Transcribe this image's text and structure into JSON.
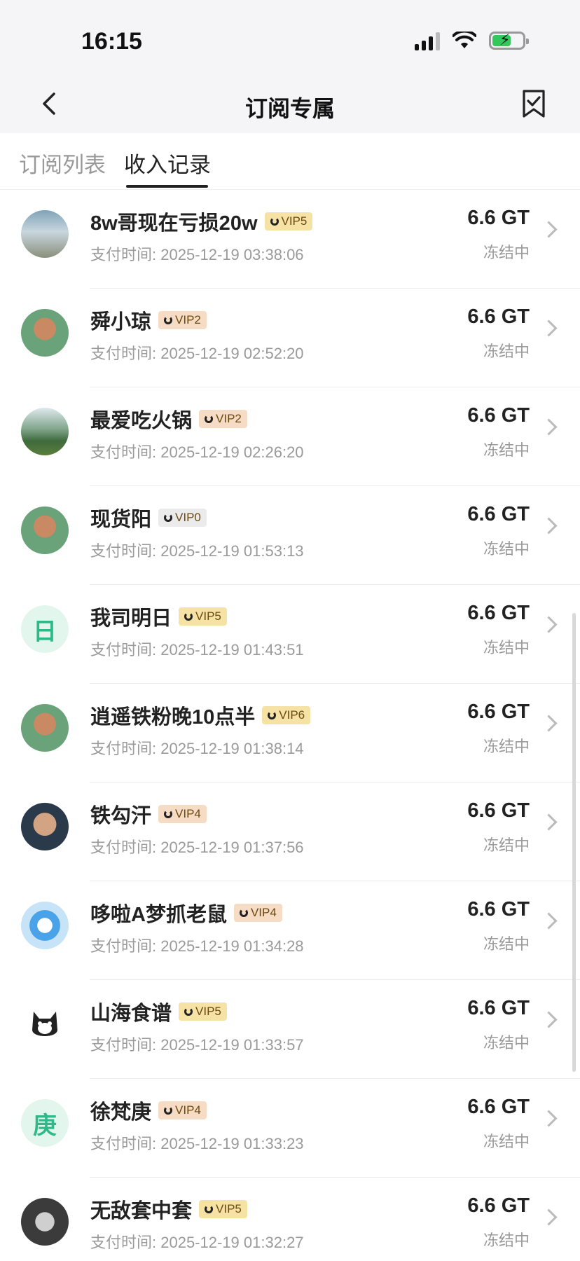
{
  "status_bar": {
    "time": "16:15"
  },
  "nav": {
    "title": "订阅专属"
  },
  "tabs": [
    {
      "label": "订阅列表",
      "active": false
    },
    {
      "label": "收入记录",
      "active": true
    }
  ],
  "colors": {
    "vip_gold": "#f7e2a6",
    "vip_orange": "#f6dcc4",
    "vip_gray": "#ebebeb",
    "letter_avatar_bg": "#e3f6ee",
    "letter_avatar_text": "#2fb88a"
  },
  "records": [
    {
      "name": "8w哥现在亏损20w",
      "vip": "VIP5",
      "time_label": "支付时间:",
      "time": "2025-12-19 03:38:06",
      "amount": "6.6 GT",
      "status": "冻结中",
      "avatar": "landscape-photo"
    },
    {
      "name": "舜小琼",
      "vip": "VIP2",
      "time_label": "支付时间:",
      "time": "2025-12-19 02:52:20",
      "amount": "6.6 GT",
      "status": "冻结中",
      "avatar": "default-man-avatar"
    },
    {
      "name": "最爱吃火锅",
      "vip": "VIP2",
      "time_label": "支付时间:",
      "time": "2025-12-19 02:26:20",
      "amount": "6.6 GT",
      "status": "冻结中",
      "avatar": "lake-photo"
    },
    {
      "name": "现货阳",
      "vip": "VIP0",
      "time_label": "支付时间:",
      "time": "2025-12-19 01:53:13",
      "amount": "6.6 GT",
      "status": "冻结中",
      "avatar": "default-man-avatar"
    },
    {
      "name": "我司明日",
      "vip": "VIP5",
      "time_label": "支付时间:",
      "time": "2025-12-19 01:43:51",
      "amount": "6.6 GT",
      "status": "冻结中",
      "avatar": "letter",
      "letter": "日"
    },
    {
      "name": "逍遥铁粉晚10点半",
      "vip": "VIP6",
      "time_label": "支付时间:",
      "time": "2025-12-19 01:38:14",
      "amount": "6.6 GT",
      "status": "冻结中",
      "avatar": "default-man-avatar"
    },
    {
      "name": "铁勾汗",
      "vip": "VIP4",
      "time_label": "支付时间:",
      "time": "2025-12-19 01:37:56",
      "amount": "6.6 GT",
      "status": "冻结中",
      "avatar": "man-photo"
    },
    {
      "name": "哆啦A梦抓老鼠",
      "vip": "VIP4",
      "time_label": "支付时间:",
      "time": "2025-12-19 01:34:28",
      "amount": "6.6 GT",
      "status": "冻结中",
      "avatar": "doraemon-photo"
    },
    {
      "name": "山海食谱",
      "vip": "VIP5",
      "time_label": "支付时间:",
      "time": "2025-12-19 01:33:57",
      "amount": "6.6 GT",
      "status": "冻结中",
      "avatar": "cat-illustration"
    },
    {
      "name": "徐梵庚",
      "vip": "VIP4",
      "time_label": "支付时间:",
      "time": "2025-12-19 01:33:23",
      "amount": "6.6 GT",
      "status": "冻结中",
      "avatar": "letter",
      "letter": "庚"
    },
    {
      "name": "无敌套中套",
      "vip": "VIP5",
      "time_label": "支付时间:",
      "time": "2025-12-19 01:32:27",
      "amount": "6.6 GT",
      "status": "冻结中",
      "avatar": "monkey-king-photo"
    }
  ]
}
